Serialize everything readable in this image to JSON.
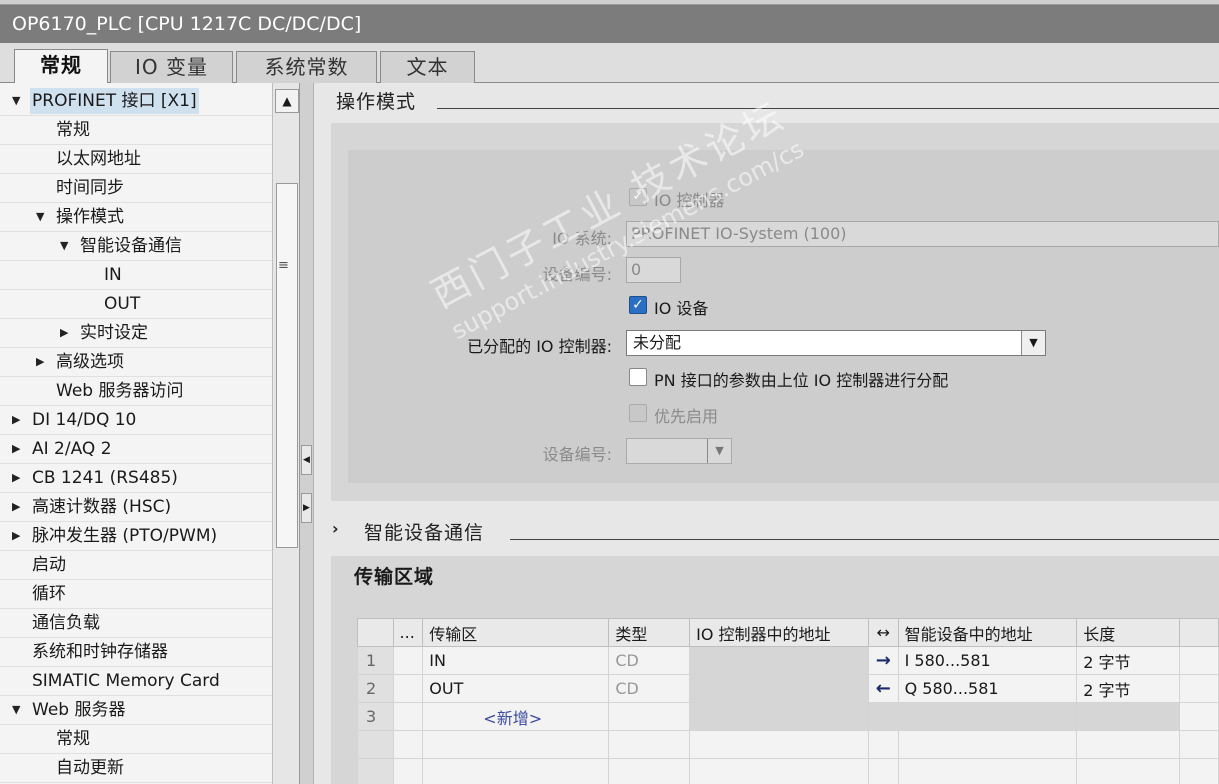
{
  "window": {
    "title": "OP6170_PLC [CPU 1217C DC/DC/DC]"
  },
  "tabs": [
    {
      "label": "常规",
      "active": true
    },
    {
      "label": "IO 变量",
      "active": false
    },
    {
      "label": "系统常数",
      "active": false
    },
    {
      "label": "文本",
      "active": false
    }
  ],
  "tree": {
    "items": [
      {
        "label": "PROFINET 接口 [X1]",
        "expander": "▼"
      },
      {
        "label": "常规",
        "expander": ""
      },
      {
        "label": "以太网地址",
        "expander": ""
      },
      {
        "label": "时间同步",
        "expander": ""
      },
      {
        "label": "操作模式",
        "expander": "▼"
      },
      {
        "label": "智能设备通信",
        "expander": "▼"
      },
      {
        "label": "IN",
        "expander": ""
      },
      {
        "label": "OUT",
        "expander": ""
      },
      {
        "label": "实时设定",
        "expander": "▶"
      },
      {
        "label": "高级选项",
        "expander": "▶"
      },
      {
        "label": "Web 服务器访问",
        "expander": ""
      },
      {
        "label": "DI 14/DQ 10",
        "expander": "▶"
      },
      {
        "label": "AI 2/AQ 2",
        "expander": "▶"
      },
      {
        "label": "CB 1241 (RS485)",
        "expander": "▶"
      },
      {
        "label": "高速计数器 (HSC)",
        "expander": "▶"
      },
      {
        "label": "脉冲发生器 (PTO/PWM)",
        "expander": "▶"
      },
      {
        "label": "启动",
        "expander": ""
      },
      {
        "label": "循环",
        "expander": ""
      },
      {
        "label": "通信负载",
        "expander": ""
      },
      {
        "label": "系统和时钟存储器",
        "expander": ""
      },
      {
        "label": "SIMATIC Memory Card",
        "expander": ""
      },
      {
        "label": "Web 服务器",
        "expander": "▼"
      },
      {
        "label": "常规",
        "expander": ""
      },
      {
        "label": "自动更新",
        "expander": ""
      }
    ]
  },
  "operating_mode": {
    "section_title": "操作模式",
    "io_controller_label": "IO 控制器",
    "io_system_label": "IO 系统:",
    "io_system_value": "PROFINET IO-System (100)",
    "device_number_label": "设备编号:",
    "device_number_value": "0",
    "io_device_label": "IO 设备",
    "assigned_controller_label": "已分配的 IO 控制器:",
    "assigned_controller_value": "未分配",
    "pn_param_label": "PN 接口的参数由上位 IO 控制器进行分配",
    "priority_startup_label": "优先启用",
    "device_number2_label": "设备编号:"
  },
  "smart_device": {
    "section_title": "智能设备通信",
    "expander": "›"
  },
  "transfer": {
    "title": "传输区域",
    "columns": [
      "...",
      "传输区",
      "类型",
      "IO 控制器中的地址",
      "↔",
      "智能设备中的地址",
      "长度"
    ],
    "rows": [
      {
        "num": "1",
        "name": "IN",
        "type": "CD",
        "ctrl_addr": "",
        "dir": "→",
        "dev_addr": "I 580...581",
        "length": "2 字节"
      },
      {
        "num": "2",
        "name": "OUT",
        "type": "CD",
        "ctrl_addr": "",
        "dir": "←",
        "dev_addr": "Q 580...581",
        "length": "2 字节"
      },
      {
        "num": "3",
        "name": "<新增>",
        "type": "",
        "ctrl_addr": "",
        "dir": "",
        "dev_addr": "",
        "length": ""
      }
    ]
  },
  "watermark": {
    "line1": "西门子工业 技术论坛",
    "line2": "support.industry.siemens.com/cs"
  }
}
